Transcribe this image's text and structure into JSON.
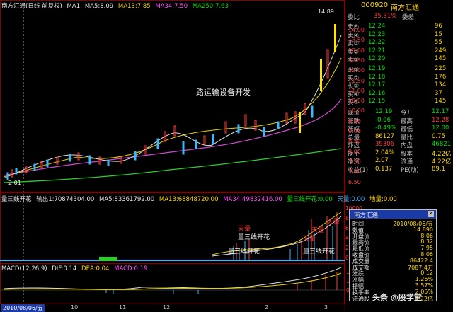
{
  "main_header": {
    "title": "南方汇通(日线 前复权)",
    "ma1": "MA1",
    "ma5": "MA5:8.09",
    "ma13": "MA13:7.85",
    "ma34": "MA34:7.50",
    "ma250": "MA250:7.63"
  },
  "price_axis": [
    "14.00",
    "13.50",
    "13.00",
    "12.50",
    "12.00",
    "11.50",
    "11.00",
    "10.50",
    "10.00",
    "9.50",
    "9.00",
    "8.50",
    "8.00",
    "7.50",
    "7.00",
    "6.50"
  ],
  "chart_annotations": {
    "main_caption": "路运输设备开发",
    "high_label": "14.89",
    "low_label": "2.01"
  },
  "volume_header": {
    "title": "量三线开花",
    "vol": "输出1:70874304.00",
    "ma5": "MA5:83361792.00",
    "ma13": "MA13:68848720.00",
    "ma34": "MA34:49832416.00",
    "kaihua": "量三线开花:0.00",
    "tianliang": "天量:0.00",
    "diliang": "地量:0.00"
  },
  "volume_annotations": {
    "tianliang1": "天量",
    "kaihua_label": "量三线开花",
    "kaihua_label2": "量三线开花",
    "kaihua_label3": "量三线开花",
    "tianliang2": "天量",
    "tianliang3": "天量",
    "tianliang4": "天量"
  },
  "volume_axis": [
    "10000",
    "8000",
    "6000",
    "4000",
    "2000",
    "0"
  ],
  "macd_header": {
    "title": "MACD(12,26,9)",
    "dif": "DIF:0.14",
    "dea": "DEA:0.04",
    "macd": "MACD:0.19"
  },
  "macd_axis": [
    "1.50",
    "1.00",
    "0.50"
  ],
  "time_axis": {
    "date": "2010/08/06/五",
    "labels": [
      "10",
      "11",
      "12",
      "2",
      "3"
    ]
  },
  "quote": {
    "code": "000920",
    "name": "南方汇通",
    "weibi_label": "委比",
    "weibi_value": "35.31%",
    "weicha_label": "委差",
    "weicha_value": "",
    "sells": [
      {
        "label": "卖⑤",
        "price": "12.24",
        "vol": "96"
      },
      {
        "label": "卖④",
        "price": "12.23",
        "vol": "15"
      },
      {
        "label": "卖③",
        "price": "12.22",
        "vol": "55"
      },
      {
        "label": "卖②",
        "price": "12.21",
        "vol": "249"
      },
      {
        "label": "卖①",
        "price": "12.20",
        "vol": "145"
      }
    ],
    "buys": [
      {
        "label": "买①",
        "price": "12.19",
        "vol": "225"
      },
      {
        "label": "买②",
        "price": "12.18",
        "vol": "176"
      },
      {
        "label": "买③",
        "price": "12.17",
        "vol": "134"
      },
      {
        "label": "买④",
        "price": "12.16",
        "vol": "37"
      },
      {
        "label": "买⑤",
        "price": "12.15",
        "vol": "145"
      }
    ],
    "stats": [
      {
        "l1": "现价",
        "v1": "12.19",
        "l2": "今开",
        "v2": "12.17",
        "c1": "green",
        "c2": "green"
      },
      {
        "l1": "涨跌",
        "v1": "-0.06",
        "l2": "最高",
        "v2": "12.28",
        "c1": "green",
        "c2": "red"
      },
      {
        "l1": "涨幅",
        "v1": "-0.49%",
        "l2": "最低",
        "v2": "12.00",
        "c1": "green",
        "c2": "green"
      },
      {
        "l1": "总量",
        "v1": "86127",
        "l2": "量比",
        "v2": "0.75",
        "c1": "yellow",
        "c2": "yellow"
      },
      {
        "l1": "外盘",
        "v1": "39306",
        "l2": "内盘",
        "v2": "46821",
        "c1": "red",
        "c2": "green"
      },
      {
        "l1": "换手",
        "v1": "2.04%",
        "l2": "股本",
        "v2": "4.22亿",
        "c1": "yellow",
        "c2": "yellow"
      },
      {
        "l1": "净资",
        "v1": "2.07",
        "l2": "流通",
        "v2": "4.22亿",
        "c1": "yellow",
        "c2": "yellow"
      },
      {
        "l1": "收益(1)",
        "v1": "0.137",
        "l2": "PE(动)",
        "v2": "89.1",
        "c1": "yellow",
        "c2": "yellow"
      }
    ]
  },
  "info_popup": {
    "title": "南方汇通",
    "rows": [
      {
        "label": "时间",
        "value": "2010/08/06/五"
      },
      {
        "label": "数值",
        "value": "14.890"
      },
      {
        "label": "开盘价",
        "value": "8.06"
      },
      {
        "label": "最高价",
        "value": "8.32"
      },
      {
        "label": "最低价",
        "value": "7.95"
      },
      {
        "label": "收盘价",
        "value": "8.06"
      },
      {
        "label": "成交量",
        "value": "86422.4"
      },
      {
        "label": "成交额",
        "value": "7087.4万"
      },
      {
        "label": "涨跌",
        "value": "0.12"
      },
      {
        "label": "涨幅",
        "value": "1.26%"
      },
      {
        "label": "振幅",
        "value": "3.57%"
      },
      {
        "label": "换手率",
        "value": "2.05%"
      },
      {
        "label": "流通股",
        "value": "4.22亿"
      }
    ]
  },
  "watermark": "头条 @股学堂"
}
